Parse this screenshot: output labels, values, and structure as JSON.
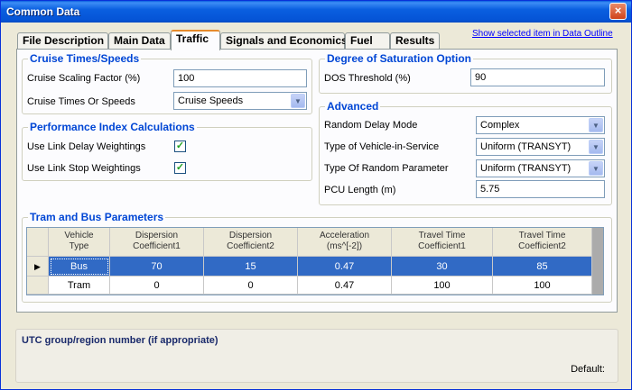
{
  "window": {
    "title": "Common Data",
    "close_glyph": "×"
  },
  "tabs": [
    "File Description",
    "Main Data",
    "Traffic",
    "Signals and Economics",
    "Fuel",
    "Results"
  ],
  "active_tab": "Traffic",
  "outline_link": "Show selected item in Data Outline",
  "cruise": {
    "title": "Cruise Times/Speeds",
    "scaling_label": "Cruise Scaling Factor (%)",
    "scaling_value": "100",
    "mode_label": "Cruise Times Or Speeds",
    "mode_value": "Cruise Speeds"
  },
  "performance": {
    "title": "Performance Index Calculations",
    "delay_label": "Use Link Delay Weightings",
    "stop_label": "Use Link Stop Weightings",
    "delay_checked": true,
    "stop_checked": true
  },
  "dos": {
    "title": "Degree of Saturation Option",
    "threshold_label": "DOS Threshold (%)",
    "threshold_value": "90"
  },
  "advanced": {
    "title": "Advanced",
    "random_delay_label": "Random Delay Mode",
    "random_delay_value": "Complex",
    "vehicle_service_label": "Type of Vehicle-in-Service",
    "vehicle_service_value": "Uniform (TRANSYT)",
    "random_param_label": "Type Of Random Parameter",
    "random_param_value": "Uniform (TRANSYT)",
    "pcu_label": "PCU Length (m)",
    "pcu_value": "5.75"
  },
  "tram_bus": {
    "title": "Tram and Bus Parameters",
    "columns": [
      [
        "Vehicle",
        "Type"
      ],
      [
        "Dispersion",
        "Coefficient1"
      ],
      [
        "Dispersion",
        "Coefficient2"
      ],
      [
        "Acceleration",
        "(ms^[-2])"
      ],
      [
        "Travel Time",
        "Coefficient1"
      ],
      [
        "Travel Time",
        "Coefficient2"
      ]
    ],
    "rows": [
      [
        "Bus",
        "70",
        "15",
        "0.47",
        "30",
        "85"
      ],
      [
        "Tram",
        "0",
        "0",
        "0.47",
        "100",
        "100"
      ]
    ],
    "selected_row": 0
  },
  "utc": {
    "label": "UTC group/region number (if appropriate)",
    "default_label": "Default:"
  },
  "colors": {
    "title_bar": "#0a5fe0",
    "group_title": "#0046d5",
    "selected_row": "#316ac5",
    "check": "#21a121",
    "active_tab_accent": "#e68b2c"
  }
}
